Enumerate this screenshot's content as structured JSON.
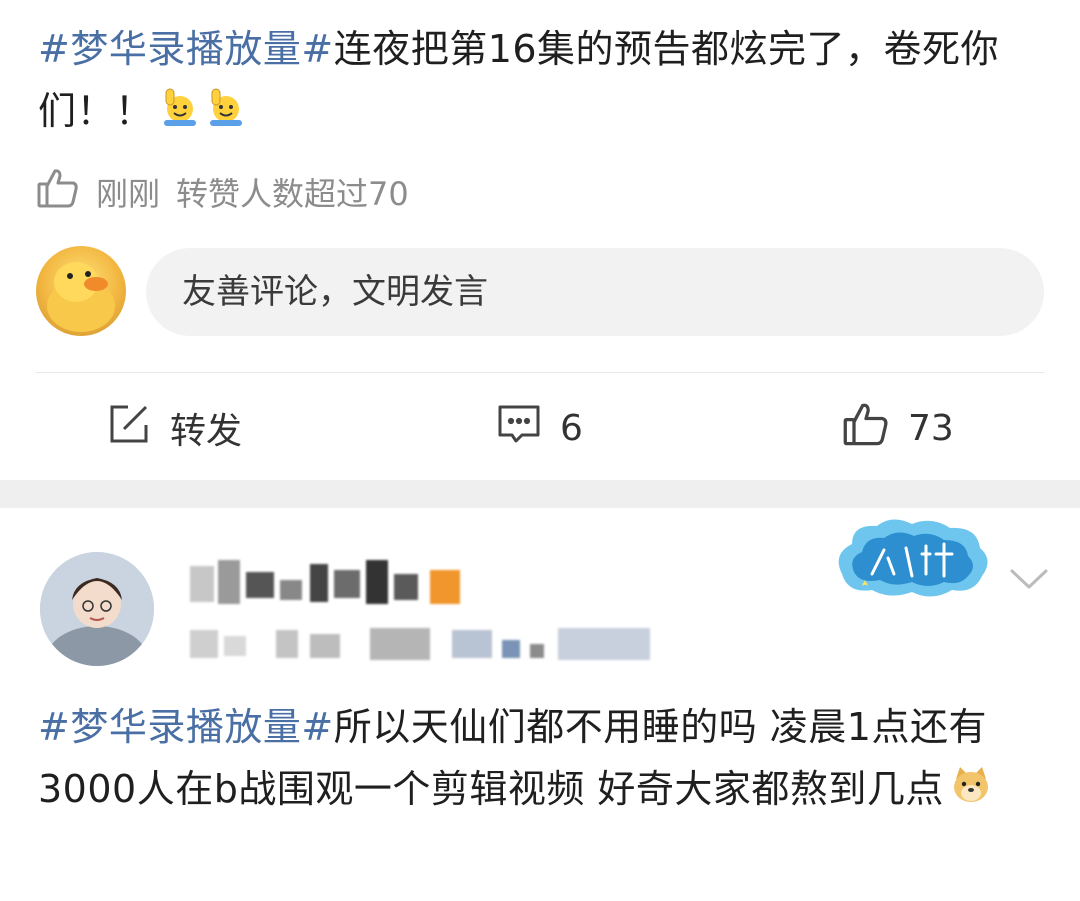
{
  "post1": {
    "hashtag": "#梦华录播放量#",
    "body": "连夜把第16集的预告都炫完了，卷死你们！！",
    "emojis": [
      "raised-hand-emoji",
      "raised-hand-emoji"
    ]
  },
  "meta": {
    "time": "刚刚",
    "stat": "转赞人数超过70"
  },
  "comment_box": {
    "placeholder": "友善评论，文明发言"
  },
  "actions": {
    "repost": "转发",
    "comments": "6",
    "likes": "73"
  },
  "post2": {
    "hashtag": "#梦华录播放量#",
    "body": "所以天仙们都不用睡的吗 凌晨1点还有3000人在b战围观一个剪辑视频 好奇大家都熬到几点",
    "emoji": "doge-emoji"
  },
  "badge": {
    "icon": "member-badge-icon"
  },
  "colors": {
    "hashtag": "#4a6fa5",
    "meta": "#8c8c8c",
    "band": "#efefef",
    "input_bg": "#f2f2f2"
  }
}
